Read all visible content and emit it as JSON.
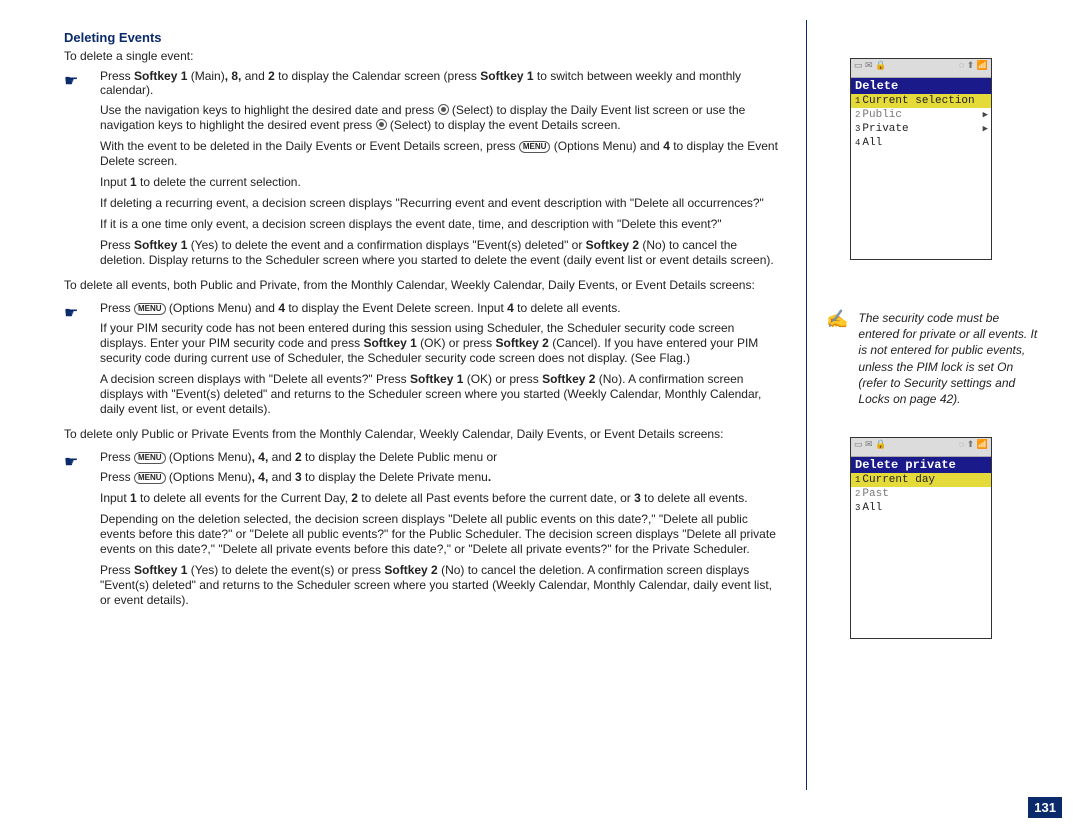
{
  "section_title": "Deleting Events",
  "intro": "To delete a single event:",
  "step1": {
    "pre": "Press ",
    "s1": "Softkey 1",
    "mid1": " (Main)",
    "s2": ", 8,",
    "mid2": " and ",
    "s3": "2",
    "mid3": " to display the Calendar screen (press ",
    "s4": "Softkey 1",
    "post": " to switch between weekly and monthly calendar)."
  },
  "sub1a": "Use the navigation keys to highlight the desired date and press ",
  "sub1a_mid": " (Select) to display the Daily Event list screen or use the navigation keys to highlight the desired event press ",
  "sub1a_end": " (Select) to display the event Details screen.",
  "sub1b_pre": "With the event to be deleted in the Daily Events or Event Details screen, press ",
  "sub1b_mid": " (Options Menu) and ",
  "sub1b_bold": "4",
  "sub1b_end": " to display the Event Delete screen.",
  "sub1c_pre": "Input ",
  "sub1c_bold": "1",
  "sub1c_end": " to delete the current selection.",
  "sub1d": "If deleting a recurring event, a decision screen displays \"Recurring event and event description with \"Delete all occurrences?\"",
  "sub1e": "If it is a one time only event, a decision screen displays the event date, time, and description with \"Delete this event?\"",
  "sub1f_pre": "Press ",
  "sub1f_s1": "Softkey 1",
  "sub1f_mid1": " (Yes) to delete the event and a confirmation displays \"Event(s) deleted\" or ",
  "sub1f_s2": "Softkey 2",
  "sub1f_end": " (No) to cancel the deletion. Display returns to the Scheduler screen where you started to delete the event (daily event list or event details screen).",
  "between1": "To delete all events, both Public and Private, from the Monthly Calendar, Weekly Calendar, Daily Events, or Event Details screens:",
  "step2_pre": "Press ",
  "step2_mid": " (Options Menu) and ",
  "step2_b4": "4",
  "step2_mid2": " to display the Event Delete screen. Input ",
  "step2_b4b": "4",
  "step2_end": " to delete all events.",
  "sub2a_pre": "If your PIM security code has not been entered during this session using Scheduler, the Scheduler security code screen displays. Enter your PIM security code and press ",
  "sub2a_s1": "Softkey 1",
  "sub2a_mid": " (OK) or press ",
  "sub2a_s2": "Softkey 2",
  "sub2a_end": " (Cancel). If you have entered your PIM security code during current use of Scheduler, the Scheduler security code screen does not display. (See Flag.)",
  "sub2b_pre": "A decision screen displays with \"Delete all events?\" Press ",
  "sub2b_s1": "Softkey 1",
  "sub2b_mid": " (OK) or press ",
  "sub2b_s2": "Softkey 2",
  "sub2b_end": " (No). A confirmation screen displays with \"Event(s) deleted\" and returns to the Scheduler screen where you started (Weekly Calendar, Monthly Calendar, daily event list, or event details).",
  "between2": "To delete only Public or Private Events from the Monthly Calendar, Weekly Calendar, Daily Events, or Event Details screens:",
  "step3a_pre": "Press ",
  "step3a_mid": " (Options Menu)",
  "step3a_b": ", 4,",
  "step3a_mid2": " and ",
  "step3a_b2": "2",
  "step3a_end": " to display the Delete Public menu or",
  "step3b_pre": "Press ",
  "step3b_mid": " (Options Menu)",
  "step3b_b": ", 4,",
  "step3b_mid2": " and ",
  "step3b_b2": "3",
  "step3b_end": " to display the Delete Private menu",
  "sub3a_pre": "Input ",
  "sub3a_1": "1",
  "sub3a_m1": " to delete all events for the Current Day, ",
  "sub3a_2": "2",
  "sub3a_m2": " to delete all Past events before the current date, or ",
  "sub3a_3": "3",
  "sub3a_end": " to delete all events.",
  "sub3b": "Depending on the deletion selected, the decision screen displays \"Delete all public events on this date?,\" \"Delete all public events before this date?\" or \"Delete all public events?\" for the Public Scheduler. The decision screen displays \"Delete all private events on this date?,\" \"Delete all private events before this date?,\" or \"Delete all private events?\" for the Private Scheduler.",
  "sub3c_pre": "Press ",
  "sub3c_s1": "Softkey 1",
  "sub3c_mid": " (Yes) to delete the event(s) or press ",
  "sub3c_s2": "Softkey 2",
  "sub3c_end": " (No) to cancel the deletion. A confirmation screen displays \"Event(s) deleted\" and returns to the Scheduler screen where you started (Weekly Calendar, Monthly Calendar, daily event list, or event details).",
  "menu_label": "MENU",
  "screenshot1": {
    "title": "Delete",
    "rows": [
      {
        "n": "1",
        "label": "Current selection",
        "hl": true,
        "arrow": false
      },
      {
        "n": "2",
        "label": "Public",
        "hl": false,
        "arrow": true,
        "dim": true
      },
      {
        "n": "3",
        "label": "Private",
        "hl": false,
        "arrow": true,
        "dim": false
      },
      {
        "n": "4",
        "label": "All",
        "hl": false,
        "arrow": false,
        "dim": false
      }
    ]
  },
  "note": "The security code must be entered for private or all events. It is not entered for public events, unless the PIM lock is set On (refer to Security settings and Locks on page 42).",
  "screenshot2": {
    "title": "Delete private",
    "rows": [
      {
        "n": "1",
        "label": "Current day",
        "hl": true
      },
      {
        "n": "2",
        "label": "Past",
        "hl": false,
        "dim": true
      },
      {
        "n": "3",
        "label": "All",
        "hl": false,
        "dim": false
      }
    ]
  },
  "status_left": "▭ ✉ 🔒",
  "status_right": "◌ ⬆ 📶",
  "page_number": "131"
}
